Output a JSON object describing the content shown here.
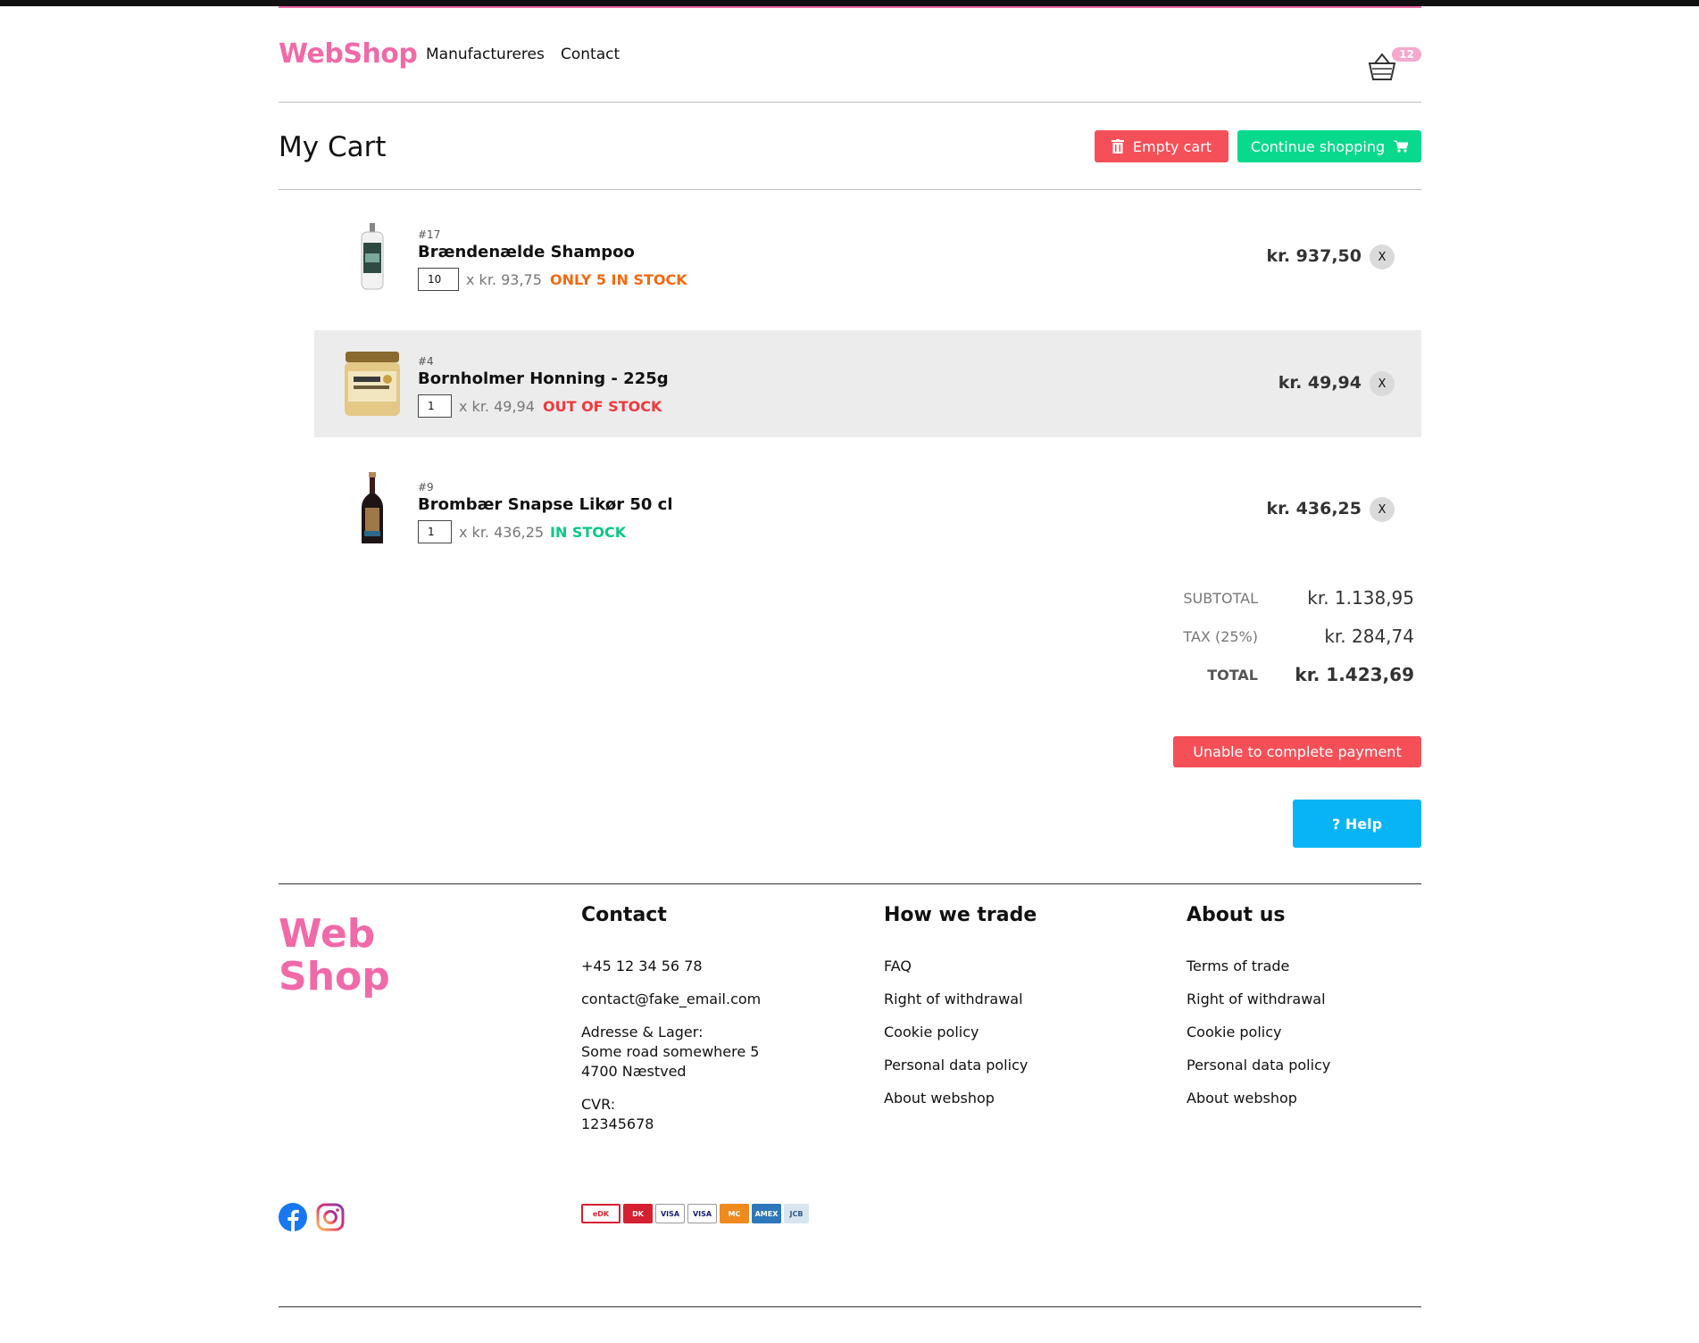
{
  "header": {
    "logo": "WebShop",
    "nav": {
      "manufacturers": "Manufactureres",
      "contact": "Contact"
    },
    "cart_count": "12"
  },
  "cart": {
    "title": "My Cart",
    "empty_label": "Empty cart",
    "continue_label": "Continue shopping",
    "items": [
      {
        "sku": "#17",
        "name": "Brændenælde Shampoo",
        "qty": "10",
        "unit_price": "x kr. 93,75",
        "stock": "ONLY 5 IN STOCK",
        "stock_color": "#f26a10",
        "line_total": "kr. 937,50",
        "remove": "X"
      },
      {
        "sku": "#4",
        "name": "Bornholmer Honning - 225g",
        "qty": "1",
        "unit_price": "x kr. 49,94",
        "stock": "OUT OF STOCK",
        "stock_color": "#f0383c",
        "line_total": "kr. 49,94",
        "remove": "X"
      },
      {
        "sku": "#9",
        "name": "Brombær Snapse Likør 50 cl",
        "qty": "1",
        "unit_price": "x kr. 436,25",
        "stock": "IN STOCK",
        "stock_color": "#09c985",
        "line_total": "kr. 436,25",
        "remove": "X"
      }
    ],
    "totals": {
      "subtotal_label": "SUBTOTAL",
      "subtotal": "kr. 1.138,95",
      "tax_label": "TAX (25%)",
      "tax": "kr. 284,74",
      "total_label": "TOTAL",
      "total": "kr. 1.423,69"
    },
    "payment_error": "Unable to complete payment",
    "help_label": "? Help"
  },
  "footer": {
    "logo_line1": "Web",
    "logo_line2": "Shop",
    "contact": {
      "heading": "Contact",
      "phone": "+45 12 34 56 78",
      "email": "contact@fake_email.com",
      "address_label": "Adresse & Lager:",
      "address_line1": "Some road somewhere 5",
      "address_line2": "4700 Næstved",
      "cvr_label": "CVR:",
      "cvr": "12345678"
    },
    "trade": {
      "heading": "How we trade",
      "links": [
        "FAQ",
        "Right of withdrawal",
        "Cookie policy",
        "Personal data policy",
        "About webshop"
      ]
    },
    "about": {
      "heading": "About us",
      "links": [
        "Terms of trade",
        "Right of withdrawal",
        "Cookie policy",
        "Personal data policy",
        "About webshop"
      ]
    },
    "payment_cards": [
      "eDK",
      "DK",
      "VISA",
      "VISA",
      "MC",
      "AMEX",
      "JCB"
    ]
  },
  "colors": {
    "brand_pink": "#f06aa8",
    "danger": "#f55058",
    "success": "#09d98c",
    "info": "#08b4f5"
  }
}
